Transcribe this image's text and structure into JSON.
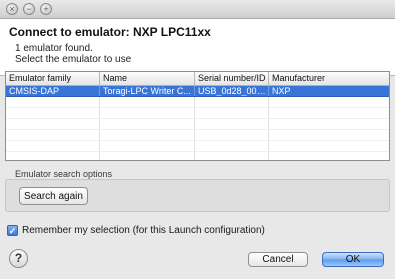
{
  "window": {
    "close_glyph": "×",
    "min_glyph": "−",
    "max_glyph": "+"
  },
  "header": {
    "title": "Connect to emulator: NXP LPC11xx",
    "found_message": "1 emulator found.",
    "instruction": "Select the emulator to use"
  },
  "table": {
    "columns": [
      "Emulator family",
      "Name",
      "Serial number/ID",
      "Manufacturer"
    ],
    "rows": [
      {
        "family": "CMSIS-DAP",
        "name": "Toragi-LPC Writer C...",
        "serial": "USB_0d28_001...",
        "manufacturer": "NXP",
        "selected": true
      }
    ]
  },
  "search_options": {
    "group_label": "Emulator search options",
    "search_button": "Search again"
  },
  "remember": {
    "label": "Remember my selection (for this Launch configuration)",
    "checked": true,
    "check_glyph": "✓"
  },
  "footer": {
    "help_glyph": "?",
    "cancel_button": "Cancel",
    "ok_button": "OK"
  },
  "colors": {
    "selection": "#3875d7",
    "ok_button": "#5d9bee"
  },
  "icons": [
    "window-close-icon",
    "window-minimize-icon",
    "window-maximize-icon",
    "checkbox-checked-icon",
    "help-icon"
  ]
}
